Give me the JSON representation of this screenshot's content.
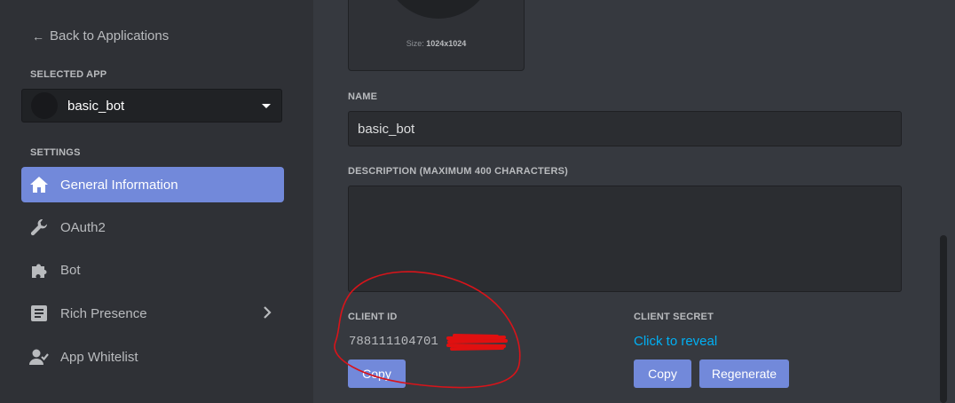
{
  "sidebar": {
    "back_label": "Back to Applications",
    "selected_app_heading": "SELECTED APP",
    "selected_app": {
      "name": "basic_bot"
    },
    "settings_heading": "SETTINGS",
    "items": [
      {
        "label": "General Information",
        "icon": "home-icon",
        "active": true
      },
      {
        "label": "OAuth2",
        "icon": "wrench-icon",
        "active": false
      },
      {
        "label": "Bot",
        "icon": "puzzle-icon",
        "active": false
      },
      {
        "label": "Rich Presence",
        "icon": "document-icon",
        "active": false,
        "has_submenu": true
      },
      {
        "label": "App Whitelist",
        "icon": "person-icon",
        "active": false
      }
    ]
  },
  "app_icon": {
    "size_label": "Size:",
    "size_value": "1024x1024"
  },
  "form": {
    "name_label": "NAME",
    "name_value": "basic_bot",
    "description_label": "DESCRIPTION (MAXIMUM 400 CHARACTERS)",
    "description_value": ""
  },
  "client_id": {
    "label": "CLIENT ID",
    "value_visible": "788111104701",
    "copy_label": "Copy"
  },
  "client_secret": {
    "label": "CLIENT SECRET",
    "reveal_label": "Click to reveal",
    "copy_label": "Copy",
    "regenerate_label": "Regenerate"
  },
  "colors": {
    "background": "#36393f",
    "sidebar": "#2f3136",
    "accent": "#7289da",
    "link": "#00b0f4",
    "annotation": "#e01010"
  }
}
